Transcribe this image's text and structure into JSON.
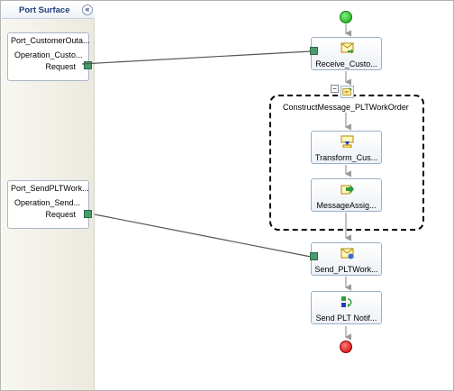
{
  "port_surface": {
    "title": "Port Surface",
    "collapse_glyph": "«",
    "ports": [
      {
        "name": "Port_CustomerOuta...",
        "operation": "Operation_Custo...",
        "request": "Request"
      },
      {
        "name": "Port_SendPLTWork...",
        "operation": "Operation_Send...",
        "request": "Request"
      }
    ]
  },
  "orchestration": {
    "shapes": [
      {
        "label": "Receive_Custo...",
        "icon": "receive-icon"
      },
      {
        "label": "Transform_Cus...",
        "icon": "transform-icon"
      },
      {
        "label": "MessageAssig...",
        "icon": "message-assignment-icon"
      },
      {
        "label": "Send_PLTWork...",
        "icon": "send-icon"
      },
      {
        "label": "Send PLT Notif...",
        "icon": "call-orchestration-icon"
      }
    ],
    "scope": {
      "label": "ConstructMessage_PLTWorkOrder",
      "collapse_glyph": "−",
      "icon": "construct-message-icon"
    }
  },
  "colors": {
    "port_handle": "#4a9a6e",
    "start": "#16a216",
    "end": "#d00000",
    "accent_title": "#1f3f7a"
  }
}
